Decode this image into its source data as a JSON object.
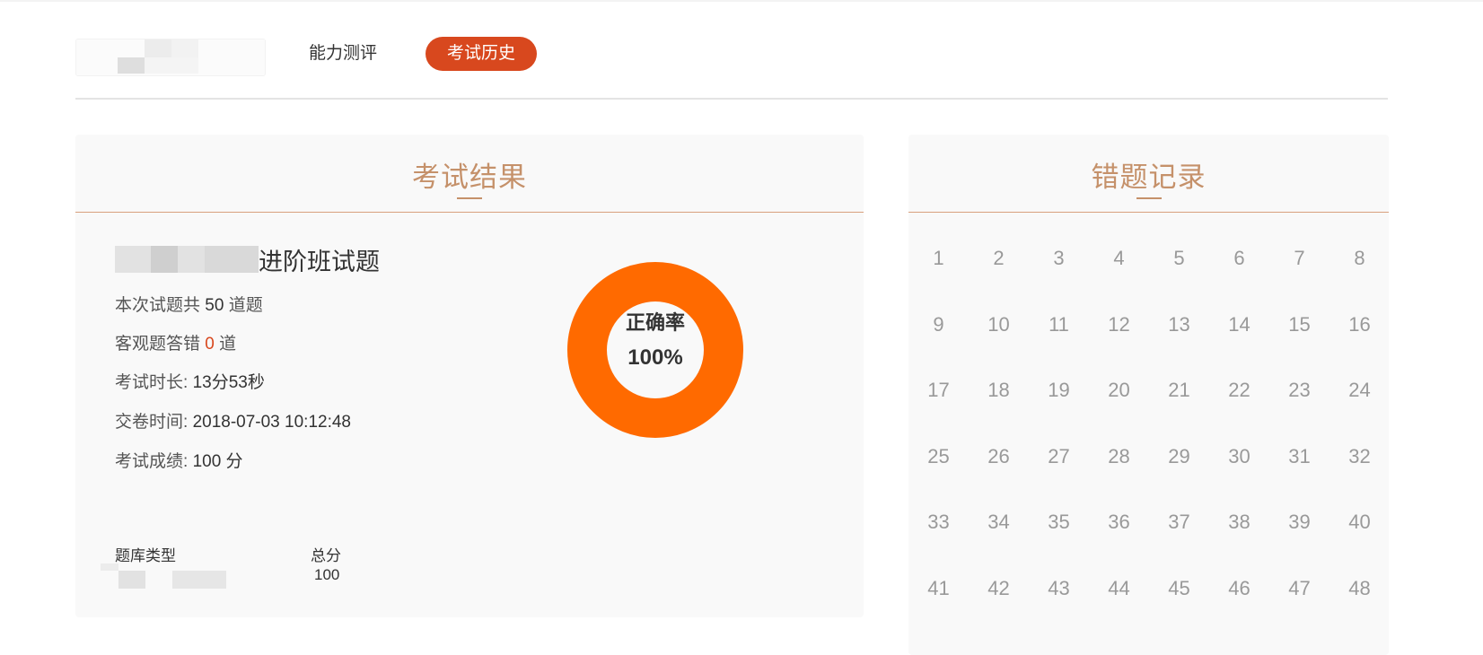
{
  "nav": {
    "items": [
      {
        "label": "能力测评",
        "active": false
      },
      {
        "label": "考试历史",
        "active": true
      }
    ]
  },
  "result_panel": {
    "title": "考试结果",
    "exam_name_suffix": "进阶班试题",
    "total_questions": {
      "prefix": "本次试题共",
      "value": "50",
      "suffix": "道题"
    },
    "objective_wrong": {
      "prefix": "客观题答错",
      "value": "0",
      "suffix": "道"
    },
    "duration": {
      "label": "考试时长:",
      "value": "13分53秒"
    },
    "submit_time": {
      "label": "交卷时间:",
      "value": "2018-07-03 10:12:48"
    },
    "score": {
      "label": "考试成绩:",
      "value": "100 分"
    },
    "table": {
      "col1_header": "题库类型",
      "col2_header": "总分",
      "col2_value": "100"
    },
    "donut": {
      "label": "正确率",
      "value_text": "100%",
      "fraction": 1.0,
      "color": "#ff6a00"
    }
  },
  "wrong_panel": {
    "title": "错题记录",
    "numbers": [
      "1",
      "2",
      "3",
      "4",
      "5",
      "6",
      "7",
      "8",
      "9",
      "10",
      "11",
      "12",
      "13",
      "14",
      "15",
      "16",
      "17",
      "18",
      "19",
      "20",
      "21",
      "22",
      "23",
      "24",
      "25",
      "26",
      "27",
      "28",
      "29",
      "30",
      "31",
      "32",
      "33",
      "34",
      "35",
      "36",
      "37",
      "38",
      "39",
      "40",
      "41",
      "42",
      "43",
      "44",
      "45",
      "46",
      "47",
      "48"
    ]
  },
  "colors": {
    "accent": "#d8481e",
    "title": "#c5916a",
    "donut": "#ff6a00"
  }
}
